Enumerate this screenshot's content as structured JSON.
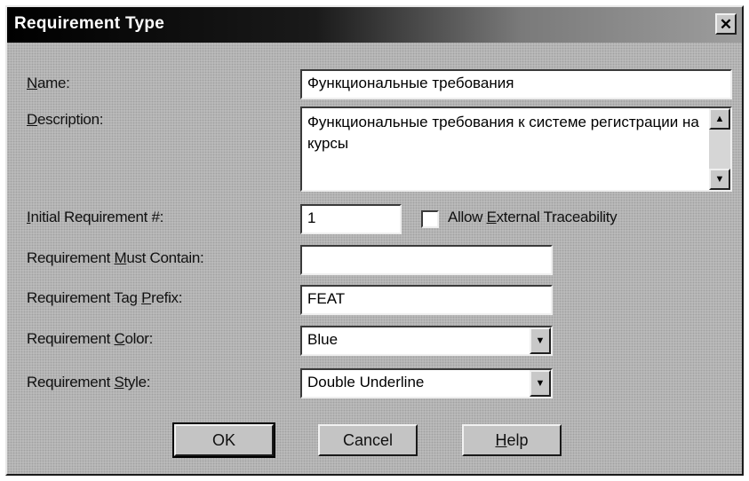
{
  "dialog": {
    "title": "Requirement Type",
    "close_symbol": "✕"
  },
  "labels": {
    "name": {
      "mnemonic": "N",
      "rest": "ame:"
    },
    "description": {
      "mnemonic": "D",
      "rest": "escription:"
    },
    "initial": {
      "mnemonic": "I",
      "rest": "nitial Requirement #:"
    },
    "must_contain": {
      "before": "Requirement ",
      "mnemonic": "M",
      "rest": "ust Contain:"
    },
    "tag_prefix": {
      "before": "Requirement Tag ",
      "mnemonic": "P",
      "rest": "refix:"
    },
    "color": {
      "before": "Requirement ",
      "mnemonic": "C",
      "rest": "olor:"
    },
    "style": {
      "before": "Requirement ",
      "mnemonic": "S",
      "rest": "tyle:"
    }
  },
  "fields": {
    "name_value": "Функциональные требования",
    "description_value": "Функциональные требования к системе регистрации на курсы",
    "initial_value": "1",
    "must_contain_value": "",
    "tag_prefix_value": "FEAT",
    "color_value": "Blue",
    "style_value": "Double Underline"
  },
  "checkbox": {
    "checked": false,
    "label_before": "Allow ",
    "mnemonic": "E",
    "label_rest": "xternal Traceability"
  },
  "icons": {
    "scroll_up": "up-arrow-icon",
    "scroll_down": "down-arrow-icon",
    "dropdown": "chevron-down-icon"
  },
  "buttons": {
    "ok": {
      "mnemonic": "",
      "label": "OK"
    },
    "cancel": {
      "label": "Cancel"
    },
    "help": {
      "mnemonic": "H",
      "rest": "elp"
    }
  },
  "colors": {
    "face": "#c0c0c0",
    "titlebar_start": "#000000",
    "titlebar_end": "#9d9d9d"
  }
}
